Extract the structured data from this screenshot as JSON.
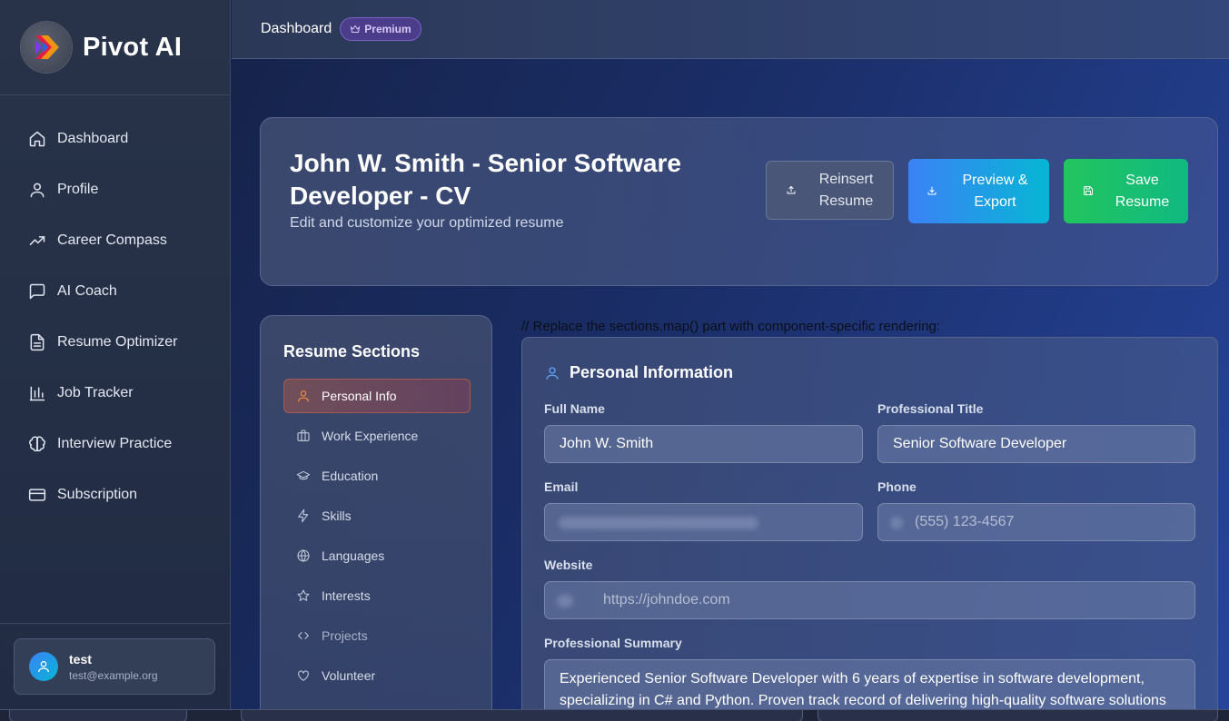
{
  "app": {
    "name": "Pivot AI"
  },
  "sidebar": {
    "items": [
      {
        "label": "Dashboard",
        "icon": "home-icon"
      },
      {
        "label": "Profile",
        "icon": "user-icon"
      },
      {
        "label": "Career Compass",
        "icon": "trending-up-icon"
      },
      {
        "label": "AI Coach",
        "icon": "message-square-icon"
      },
      {
        "label": "Resume Optimizer",
        "icon": "file-text-icon"
      },
      {
        "label": "Job Tracker",
        "icon": "bar-chart-icon"
      },
      {
        "label": "Interview Practice",
        "icon": "brain-icon"
      },
      {
        "label": "Subscription",
        "icon": "credit-card-icon"
      }
    ],
    "user": {
      "name": "test",
      "email": "test@example.org"
    }
  },
  "topbar": {
    "breadcrumb": "Dashboard",
    "badge": "Premium"
  },
  "header": {
    "title": "John W. Smith - Senior Software Developer - CV",
    "subtitle": "Edit and customize your optimized resume",
    "buttons": {
      "reinsert": "Reinsert Resume",
      "preview": "Preview & Export",
      "save": "Save Resume"
    }
  },
  "sections": {
    "title": "Resume Sections",
    "items": [
      {
        "label": "Personal Info",
        "icon": "user-icon",
        "active": true
      },
      {
        "label": "Work Experience",
        "icon": "briefcase-icon"
      },
      {
        "label": "Education",
        "icon": "graduation-cap-icon"
      },
      {
        "label": "Skills",
        "icon": "zap-icon"
      },
      {
        "label": "Languages",
        "icon": "globe-icon"
      },
      {
        "label": "Interests",
        "icon": "star-icon"
      },
      {
        "label": "Projects",
        "icon": "code-icon"
      },
      {
        "label": "Volunteer",
        "icon": "heart-icon"
      }
    ]
  },
  "note": "// Replace the sections.map() part with component-specific rendering:",
  "form": {
    "title": "Personal Information",
    "full_name": {
      "label": "Full Name",
      "value": "John W. Smith"
    },
    "professional_title": {
      "label": "Professional Title",
      "value": "Senior Software Developer"
    },
    "email": {
      "label": "Email",
      "value": ""
    },
    "phone": {
      "label": "Phone",
      "placeholder": "(555) 123-4567"
    },
    "website": {
      "label": "Website",
      "placeholder": "https://johndoe.com"
    },
    "summary": {
      "label": "Professional Summary",
      "value": "Experienced Senior Software Developer with 6 years of expertise in software development, specializing in C# and Python. Proven track record of delivering high-quality software solutions"
    }
  },
  "colors": {
    "accent_blue": "#3b82f6",
    "accent_cyan": "#06b6d4",
    "accent_green": "#22c55e",
    "premium_purple": "#7a62c8",
    "active_orange": "#fb923c"
  }
}
